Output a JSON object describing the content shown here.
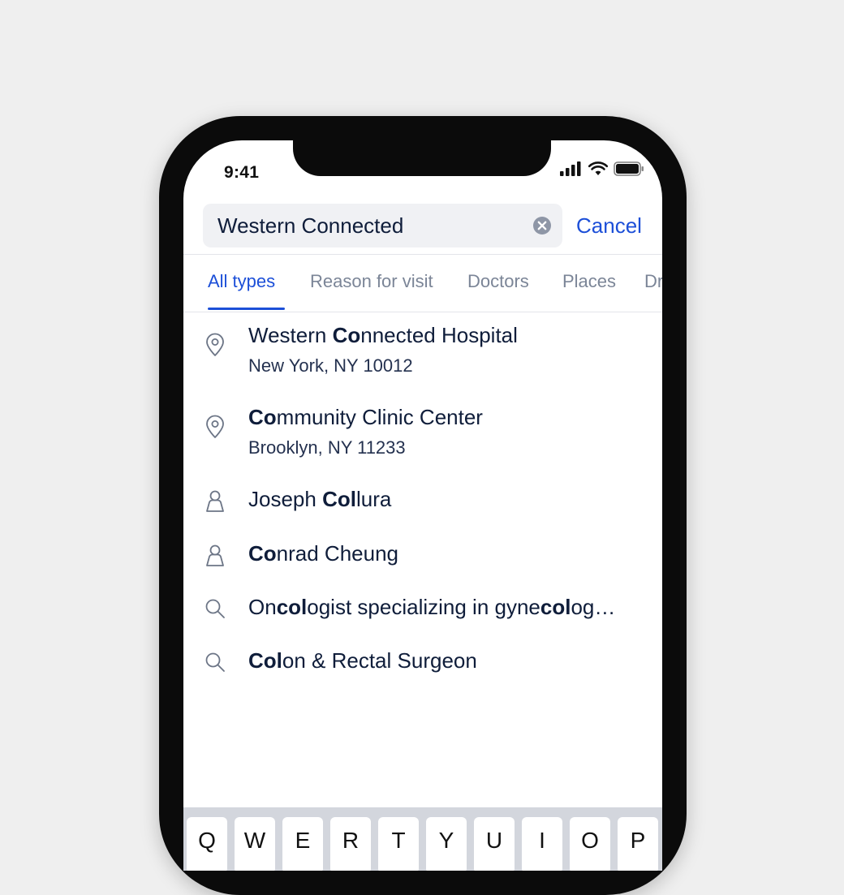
{
  "status_bar": {
    "time": "9:41"
  },
  "search": {
    "value": "Western Connected",
    "cancel_label": "Cancel"
  },
  "tabs": [
    {
      "label": "All types",
      "active": true
    },
    {
      "label": "Reason for visit",
      "active": false
    },
    {
      "label": "Doctors",
      "active": false
    },
    {
      "label": "Places",
      "active": false
    },
    {
      "label": "Dr",
      "active": false
    }
  ],
  "results": [
    {
      "icon": "location-pin-icon",
      "title_parts": [
        [
          "Western ",
          false
        ],
        [
          "Co",
          true
        ],
        [
          "nnected Hospital",
          false
        ]
      ],
      "subtitle": "New York, NY 10012"
    },
    {
      "icon": "location-pin-icon",
      "title_parts": [
        [
          "Co",
          true
        ],
        [
          "mmunity Clinic Center",
          false
        ]
      ],
      "subtitle": "Brooklyn, NY 11233"
    },
    {
      "icon": "person-icon",
      "title_parts": [
        [
          "Joseph ",
          false
        ],
        [
          "Col",
          true
        ],
        [
          "lura",
          false
        ]
      ]
    },
    {
      "icon": "person-icon",
      "title_parts": [
        [
          "Co",
          true
        ],
        [
          "nrad Cheung",
          false
        ]
      ]
    },
    {
      "icon": "search-icon",
      "title_parts": [
        [
          "On",
          false
        ],
        [
          "col",
          true
        ],
        [
          "ogist specializing in gyne",
          false
        ],
        [
          "col",
          true
        ],
        [
          "og…",
          false
        ]
      ]
    },
    {
      "icon": "search-icon",
      "title_parts": [
        [
          "Col",
          true
        ],
        [
          "on & Rectal Surgeon",
          false
        ]
      ]
    }
  ],
  "keyboard": {
    "keys": [
      "Q",
      "W",
      "E",
      "R",
      "T",
      "Y",
      "U",
      "I",
      "O",
      "P"
    ]
  },
  "colors": {
    "accent": "#1c4fd8",
    "text": "#0f1d3a",
    "muted": "#7b8597"
  }
}
